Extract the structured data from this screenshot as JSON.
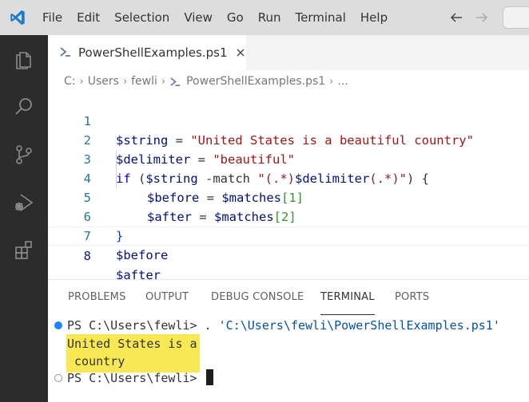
{
  "menu": [
    "File",
    "Edit",
    "Selection",
    "View",
    "Go",
    "Run",
    "Terminal",
    "Help"
  ],
  "colors": {
    "accent": "#007acc",
    "activity_bar": "#2c2c2c",
    "highlight": "#f8e854"
  },
  "tab": {
    "label": "PowerShellExamples.ps1",
    "close_glyph": "✕"
  },
  "breadcrumb": {
    "drive": "C:",
    "users": "Users",
    "user": "fewli",
    "file": "PowerShellExamples.ps1",
    "more": "..."
  },
  "editor": {
    "line_numbers": [
      "1",
      "2",
      "3",
      "4",
      "5",
      "6",
      "7",
      "8"
    ],
    "l1": {
      "var": "$string",
      "eq": " = ",
      "str": "\"United States is a beautiful country\""
    },
    "l2": {
      "var": "$delimiter",
      "eq": " = ",
      "str": "\"beautiful\""
    },
    "l3": {
      "kw": "if",
      "p1": " (",
      "var": "$string",
      "op": " -match ",
      "q1": "\"",
      "re1": "(.*)",
      "var2": "$delimiter",
      "re2": "(.*)",
      "q2": "\"",
      "p2": ") {"
    },
    "l4": {
      "var": "$before",
      "eq": " = ",
      "var2": "$matches",
      "b1": "[",
      "n": "1",
      "b2": "]"
    },
    "l5": {
      "var": "$after",
      "eq": " = ",
      "var2": "$matches",
      "b1": "[",
      "n": "2",
      "b2": "]"
    },
    "l6": {
      "brace": "}"
    },
    "l7": {
      "var": "$before"
    },
    "l8": {
      "var": "$after"
    }
  },
  "panel": {
    "tabs": [
      "PROBLEMS",
      "OUTPUT",
      "DEBUG CONSOLE",
      "TERMINAL",
      "PORTS"
    ],
    "active_tab": "TERMINAL"
  },
  "terminal": {
    "prompt1": "PS C:\\Users\\fewli> ",
    "cmd_dot": ". ",
    "cmd_str": "'C:\\Users\\fewli\\PowerShellExamples.ps1'",
    "out1": "United States is a",
    "out2": " country",
    "prompt2": "PS C:\\Users\\fewli>"
  }
}
